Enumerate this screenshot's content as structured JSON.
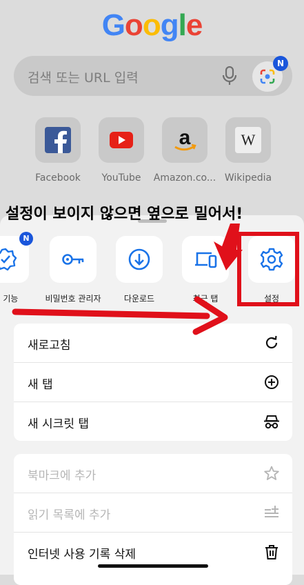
{
  "logo": {
    "letters": [
      "G",
      "o",
      "o",
      "g",
      "l",
      "e"
    ]
  },
  "search": {
    "placeholder": "검색 또는 URL 입력",
    "badge": "N"
  },
  "shortcuts": [
    {
      "label": "Facebook",
      "icon": "facebook-icon"
    },
    {
      "label": "YouTube",
      "icon": "youtube-icon"
    },
    {
      "label": "Amazon.co...",
      "icon": "amazon-icon"
    },
    {
      "label": "Wikipedia",
      "icon": "wikipedia-icon",
      "glyph": "W"
    }
  ],
  "annotation": {
    "headline": "설정이 보이지 않으면 옆으로 밀어서!",
    "color": "#e0101a"
  },
  "tools": [
    {
      "label": "운 기능",
      "icon": "verified-badge-icon",
      "badge": "N"
    },
    {
      "label": "비밀번호 관리자",
      "icon": "key-icon"
    },
    {
      "label": "다운로드",
      "icon": "download-icon"
    },
    {
      "label": "최근 탭",
      "icon": "recent-tabs-icon"
    },
    {
      "label": "설정",
      "icon": "gear-icon"
    }
  ],
  "menu_primary": [
    {
      "label": "새로고침",
      "icon": "reload-icon"
    },
    {
      "label": "새 탭",
      "icon": "new-tab-icon"
    },
    {
      "label": "새 시크릿 탭",
      "icon": "incognito-icon"
    }
  ],
  "menu_secondary": [
    {
      "label": "북마크에 추가",
      "icon": "star-icon",
      "disabled": true
    },
    {
      "label": "읽기 목록에 추가",
      "icon": "reading-list-add-icon",
      "disabled": true
    },
    {
      "label": "인터넷 사용 기록 삭제",
      "icon": "trash-icon",
      "disabled": false
    }
  ],
  "colors": {
    "accent": "#1a73e8",
    "badge": "#1a56db",
    "annotation_red": "#e0101a"
  }
}
